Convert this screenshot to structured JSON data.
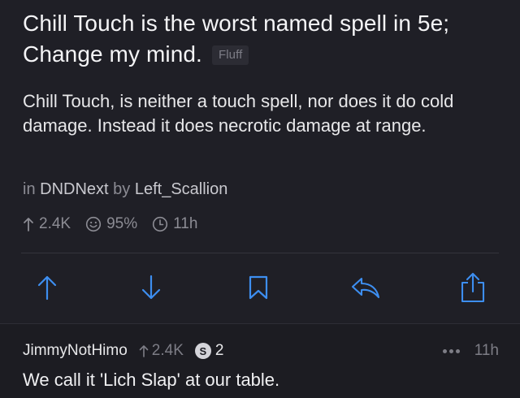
{
  "post": {
    "title": "Chill Touch is the worst named spell in 5e; Change my mind.",
    "flair": "Fluff",
    "body": "Chill Touch, is neither a touch spell, nor does it do cold damage. Instead it does necrotic damage at range.",
    "meta": {
      "prefix_in": "in",
      "subreddit": "DNDNext",
      "prefix_by": "by",
      "author": "Left_Scallion"
    },
    "stats": {
      "upvotes": "2.4K",
      "upvote_ratio": "95%",
      "age": "11h"
    }
  },
  "actions": {
    "icons": [
      "upvote-icon",
      "downvote-icon",
      "bookmark-icon",
      "reply-icon",
      "share-icon"
    ],
    "accent": "#3d8ef0"
  },
  "comment": {
    "author": "JimmyNotHimo",
    "score": "2.4K",
    "award_count": "2",
    "award_icon": "silver-award-icon",
    "age": "11h",
    "text": "We call it 'Lich Slap' at our table."
  }
}
